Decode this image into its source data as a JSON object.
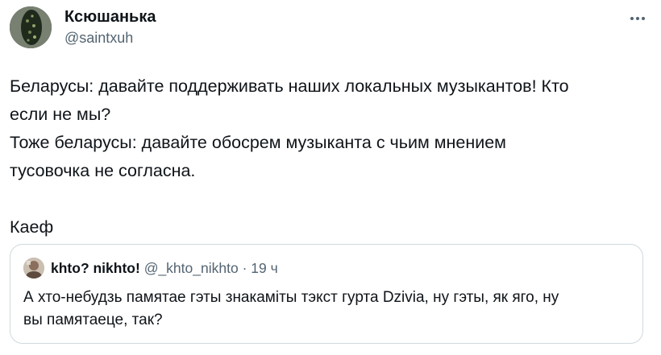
{
  "tweet": {
    "author_name": "Ксюшанька",
    "author_handle": "@saintxuh",
    "text_lines": [
      "Беларусы: давайте поддерживать наших локальных музыкантов! Кто",
      "если не мы?",
      "Тоже беларусы: давайте обосрем музыканта с чьим мнением",
      "тусовочка не согласна.",
      "",
      "Каеф"
    ]
  },
  "quote": {
    "author_name": "khto? nikhto!",
    "author_handle": "@_khto_nikhto",
    "separator": "·",
    "time": "19 ч",
    "text_lines": [
      "А хто-небудзь памятае гэты знакаміты тэкст гурта Dzivia, ну гэты, як яго, ну",
      "вы памятаеце, так?"
    ]
  },
  "icons": {
    "more": "more-horizontal-icon",
    "avatar": "user-avatar",
    "quote_avatar": "quoted-user-avatar"
  },
  "colors": {
    "text_primary": "#0f1419",
    "text_secondary": "#536471",
    "border": "#cfd9de",
    "background": "#ffffff"
  }
}
